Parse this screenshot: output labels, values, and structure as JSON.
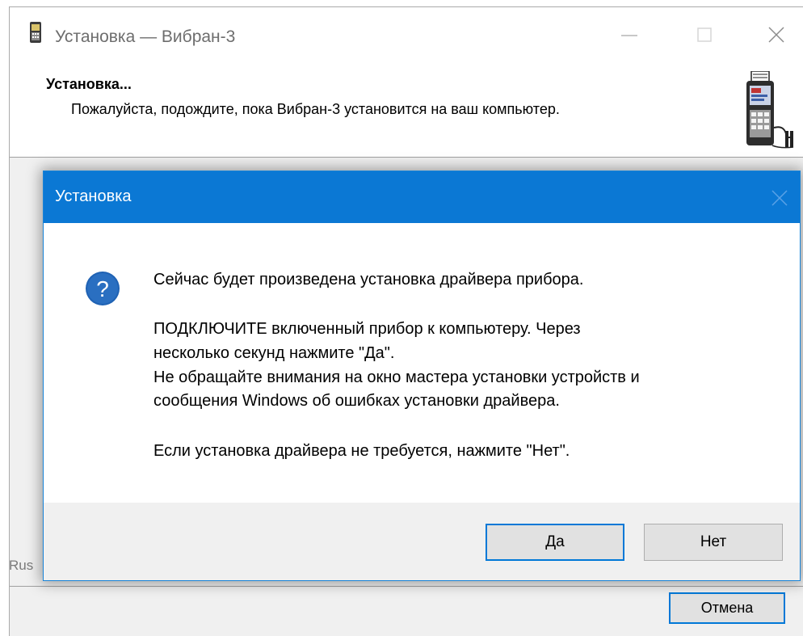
{
  "window": {
    "title": "Установка — Вибран-3",
    "icon": "device-icon"
  },
  "header": {
    "title": "Установка...",
    "subtitle": "Пожалуйста, подождите, пока Вибран-3 установится на ваш компьютер.",
    "image": "vibran-device-image"
  },
  "footer": {
    "language_label": "Rus",
    "cancel_label": "Отмена"
  },
  "dialog": {
    "title": "Установка",
    "icon": "question-icon",
    "messages": [
      "Сейчас будет произведена установка драйвера прибора.",
      "ПОДКЛЮЧИТЕ включенный прибор к компьютеру. Через",
      "несколько секунд нажмите \"Да\".",
      "Не обращайте внимания на окно мастера установки устройств и",
      "сообщения Windows об ошибках установки драйвера.",
      "Если установка драйвера не требуется, нажмите \"Нет\"."
    ],
    "yes_label": "Да",
    "no_label": "Нет"
  },
  "colors": {
    "accent": "#0078d7",
    "dialog_title_bg": "#0b78d4",
    "window_bg": "#f0f0f0"
  }
}
